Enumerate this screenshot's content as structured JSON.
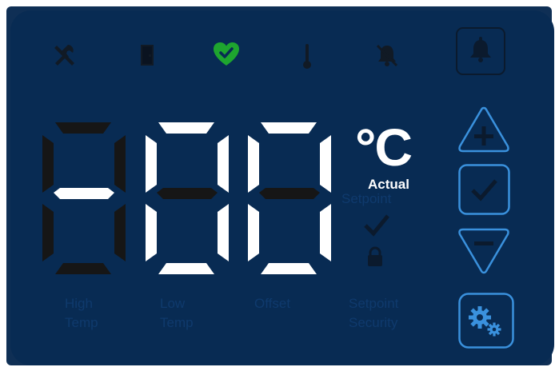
{
  "display": {
    "unit": "°C",
    "actual_label": "Actual",
    "setpoint_label": "Setpoint",
    "segments_lit": {
      "digit1": [
        false,
        false,
        false,
        false,
        false,
        false,
        true
      ],
      "digit2": [
        true,
        true,
        true,
        true,
        true,
        true,
        false
      ],
      "digit3": [
        true,
        true,
        true,
        true,
        true,
        true,
        false
      ]
    }
  },
  "status_icons": [
    {
      "name": "tools-icon",
      "active": false
    },
    {
      "name": "door-icon",
      "active": false
    },
    {
      "name": "heart-check-icon",
      "active": true
    },
    {
      "name": "thermometer-icon",
      "active": false
    },
    {
      "name": "bell-mute-icon",
      "active": false
    }
  ],
  "indicators": {
    "high_temp": [
      "High",
      "Temp"
    ],
    "low_temp": [
      "Low",
      "Temp"
    ],
    "offset": "Offset",
    "setpoint_security": [
      "Setpoint",
      "Security"
    ]
  },
  "controls": {
    "alarm_button": "bell-icon",
    "up_button": "plus-icon",
    "confirm_button": "check-icon",
    "down_button": "minus-icon",
    "settings_button": "gears-icon"
  },
  "colors": {
    "background": "#082b53",
    "accent": "#3a91dd",
    "active_green": "#1ea52f",
    "segment_on": "#ffffff",
    "segment_off": "#161616",
    "inactive_icon": "#111a25"
  }
}
